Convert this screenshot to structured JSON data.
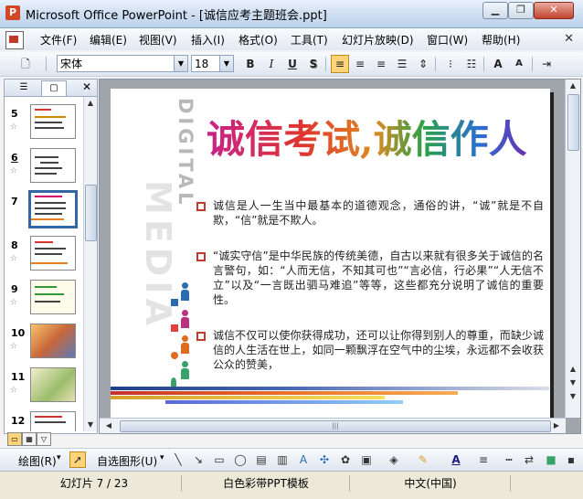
{
  "window": {
    "title": "Microsoft Office PowerPoint - [诚信应考主题班会.ppt]"
  },
  "menu": [
    "文件(F)",
    "编辑(E)",
    "视图(V)",
    "插入(I)",
    "格式(O)",
    "工具(T)",
    "幻灯片放映(D)",
    "窗口(W)",
    "帮助(H)"
  ],
  "toolbar": {
    "font_name": "宋体",
    "font_size": "18",
    "bold": "B",
    "italic": "I",
    "underline": "U",
    "shadow": "S",
    "grow_font": "A",
    "shrink_font": "A"
  },
  "slides_panel": {
    "items": [
      {
        "number": "5"
      },
      {
        "number": "6"
      },
      {
        "number": "7",
        "selected": true
      },
      {
        "number": "8"
      },
      {
        "number": "9"
      },
      {
        "number": "10"
      },
      {
        "number": "11"
      },
      {
        "number": "12"
      }
    ]
  },
  "slide": {
    "deco_small": "DIGITAL",
    "deco_large": "MEDIA",
    "title": "诚信考试,诚信作人",
    "bullets": [
      "诚信是人一生当中最基本的道德观念，通俗的讲，“诚”就是不自欺，“信”就是不欺人。",
      "“诚实守信”是中华民族的传统美德，自古以来就有很多关于诚信的名言警句，如：“人而无信，不知其可也”“言必信，行必果”“人无信不立”以及“一言既出驷马难追”等等，这些都充分说明了诚信的重要性。",
      "诚信不仅可以使你获得成功，还可以让你得到别人的尊重，而缺少诚信的人生活在世上，如同一颗飘浮在空气中的尘埃，永远都不会收获公众的赞美，"
    ]
  },
  "drawing_toolbar": {
    "draw_label": "绘图(R)",
    "autoshape_label": "自选图形(U)"
  },
  "status": {
    "slide_info": "幻灯片 7 / 23",
    "template": "白色彩带PPT模板",
    "language": "中文(中国)"
  }
}
